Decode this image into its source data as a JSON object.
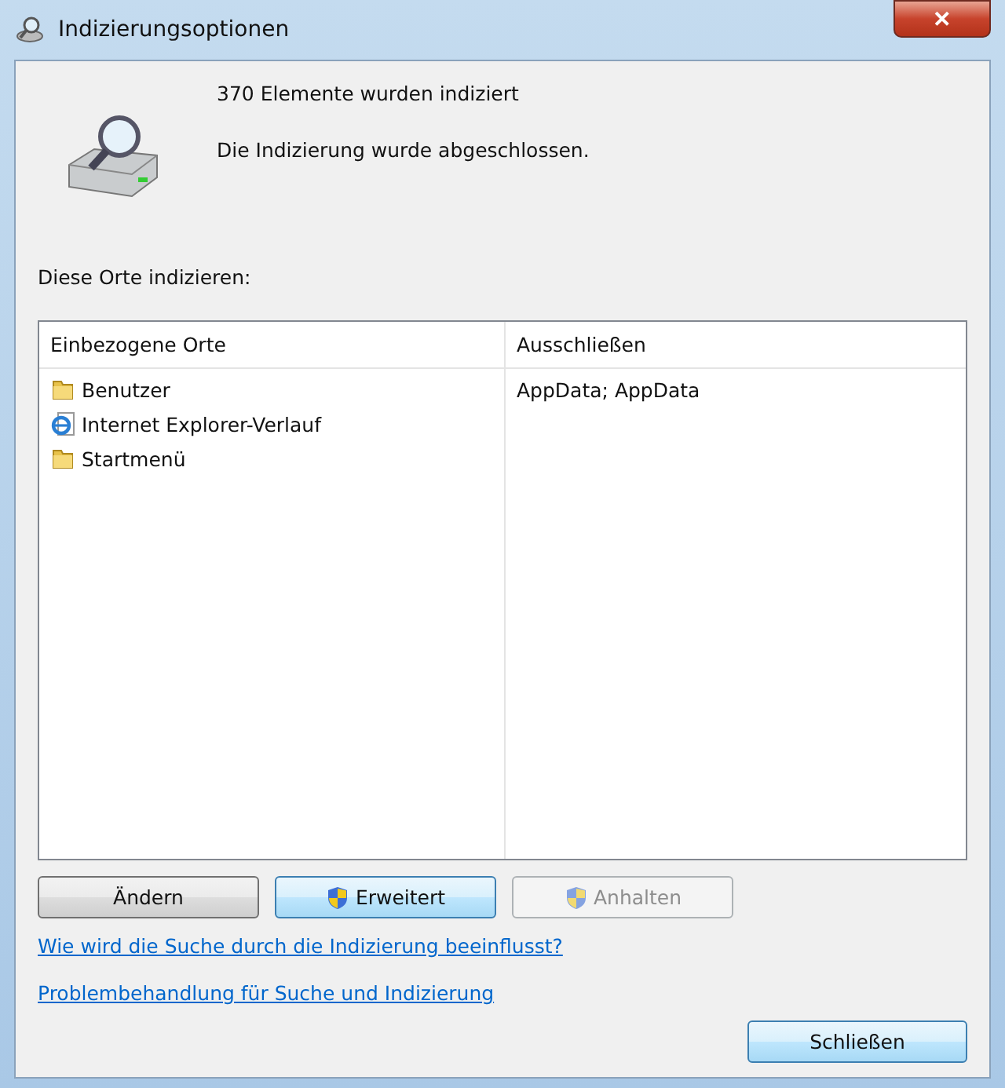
{
  "window": {
    "title": "Indizierungsoptionen",
    "close_glyph": "✕"
  },
  "status": {
    "count": "370 Elemente wurden indiziert",
    "message": "Die Indizierung wurde abgeschlossen."
  },
  "section_label": "Diese Orte indizieren:",
  "table": {
    "columns": [
      "Einbezogene Orte",
      "Ausschließen"
    ],
    "rows": [
      {
        "kind": "folder",
        "location": "Benutzer",
        "exclude": "AppData; AppData"
      },
      {
        "kind": "browser",
        "location": "Internet Explorer-Verlauf"
      },
      {
        "kind": "folder",
        "location": "Startmenü"
      }
    ]
  },
  "buttons": [
    {
      "label": "Ändern",
      "shield": false,
      "highlighted": false,
      "disabled": false
    },
    {
      "label": "Erweitert",
      "shield": true,
      "highlighted": true,
      "disabled": false
    },
    {
      "label": "Anhalten",
      "shield": true,
      "highlighted": false,
      "disabled": true
    }
  ],
  "links": [
    "Wie wird die Suche durch die Indizierung beeinflusst?",
    "Problembehandlung für Suche und Indizierung"
  ],
  "close_button": {
    "label": "Schließen",
    "highlighted": true
  }
}
